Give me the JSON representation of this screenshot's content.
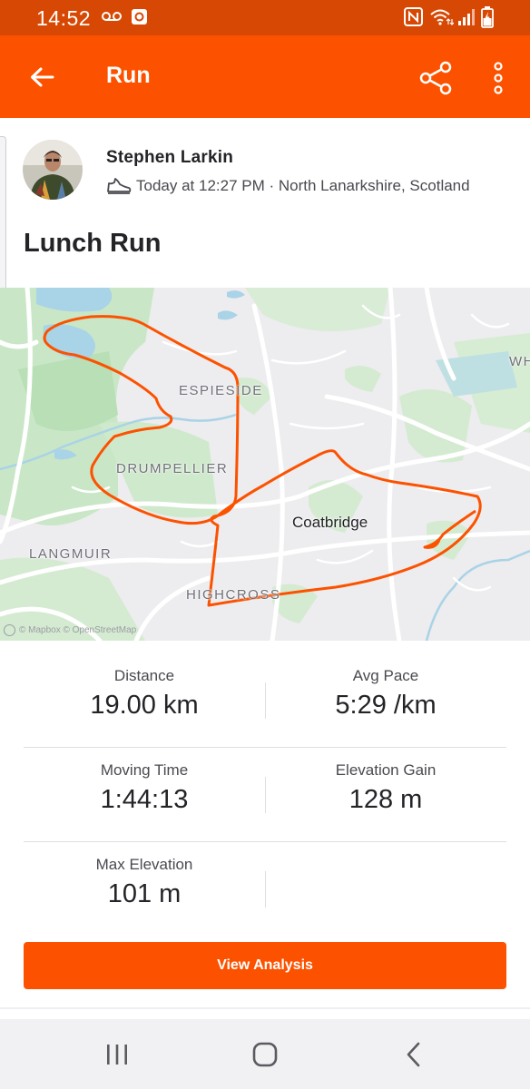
{
  "status_bar": {
    "time": "14:52",
    "icons": [
      "voicemail-icon",
      "strava-notification-icon",
      "nfc-icon",
      "wifi-icon",
      "signal-icon",
      "battery-charging-icon"
    ]
  },
  "app_bar": {
    "title": "Run",
    "icons": [
      "back-arrow-icon",
      "share-icon",
      "more-vertical-icon"
    ]
  },
  "activity": {
    "athlete_name": "Stephen Larkin",
    "meta": "Today at 12:27 PM · North Lanarkshire, Scotland",
    "meta_icon": "shoe-icon",
    "title": "Lunch Run"
  },
  "map": {
    "labels": {
      "espieside": "ESPIESIDE",
      "drumpellier": "DRUMPELLIER",
      "coatbridge": "Coatbridge",
      "langmuir": "LANGMUIR",
      "highcross": "HIGHCROSS",
      "wh": "WH"
    },
    "attribution": "© Mapbox © OpenStreetMap",
    "route_color": "#fc5200"
  },
  "stats": {
    "distance": {
      "label": "Distance",
      "value": "19.00 km"
    },
    "avg_pace": {
      "label": "Avg Pace",
      "value": "5:29 /km"
    },
    "moving_time": {
      "label": "Moving Time",
      "value": "1:44:13"
    },
    "elevation_gain": {
      "label": "Elevation Gain",
      "value": "128 m"
    },
    "max_elevation": {
      "label": "Max Elevation",
      "value": "101 m"
    }
  },
  "actions": {
    "view_analysis": "View Analysis"
  },
  "nav_bar": {
    "icons": [
      "recent-apps-icon",
      "home-icon",
      "back-icon"
    ]
  },
  "colors": {
    "brand": "#fc5200",
    "status_bar": "#d74804",
    "text": "#242428"
  }
}
